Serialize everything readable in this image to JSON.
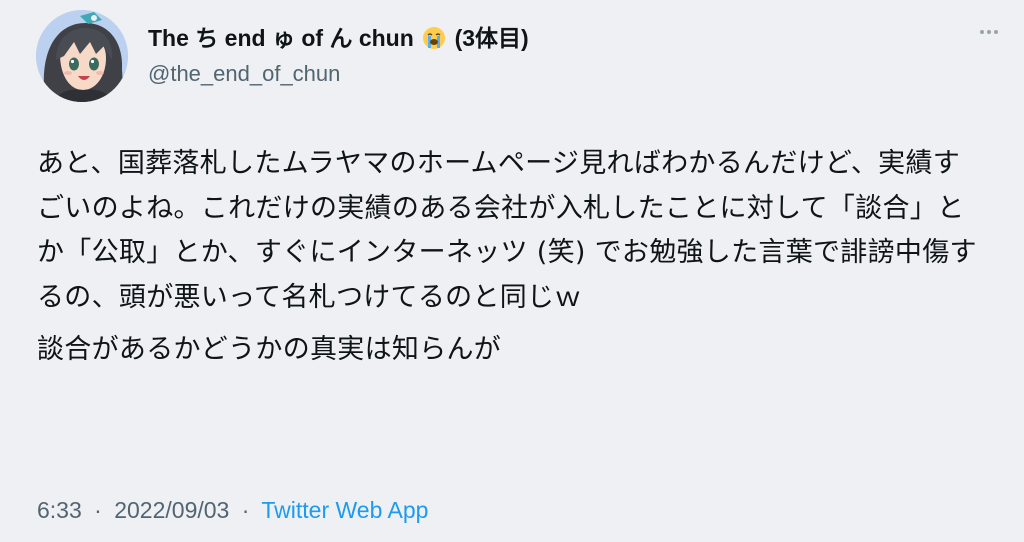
{
  "author": {
    "display_name_prefix": "The ち end ゅ of ん chun",
    "emoji_icon": "loudly-crying-face",
    "display_name_suffix": "(3体目)",
    "handle": "@the_end_of_chun"
  },
  "tweet": {
    "paragraphs": [
      "あと、国葬落札したムラヤマのホームページ見ればわかるんだけど、実績すごいのよね。これだけの実績のある会社が入札したことに対して「談合」とか「公取」とか、すぐにインターネッツ (笑) でお勉強した言葉で誹謗中傷するの、頭が悪いって名札つけてるのと同じｗ",
      "談合があるかどうかの真実は知らんが"
    ]
  },
  "meta": {
    "time": "6:33",
    "separator": "·",
    "date": "2022/09/03",
    "source": "Twitter Web App"
  },
  "colors": {
    "background": "#eef0f3",
    "text": "#0f1419",
    "secondary": "#536471",
    "link": "#1d9bf0"
  }
}
